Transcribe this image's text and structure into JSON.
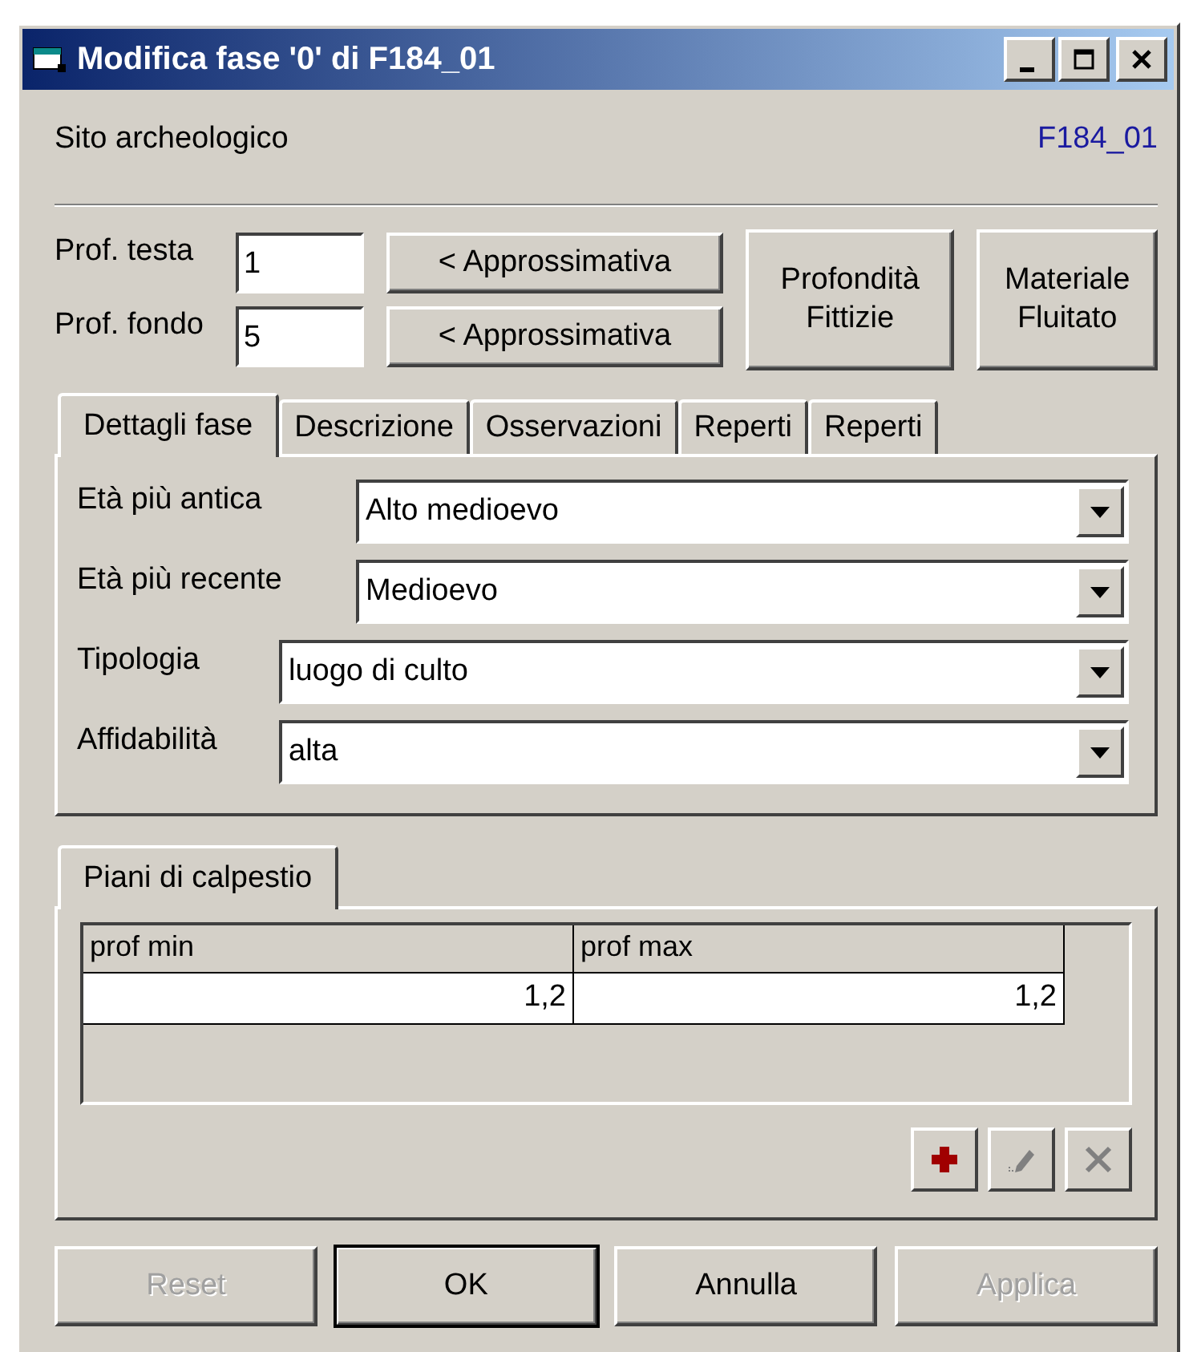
{
  "window": {
    "title": "Modifica fase '0' di F184_01"
  },
  "site": {
    "label": "Sito archeologico",
    "code": "F184_01"
  },
  "depths": [
    {
      "label": "Prof. testa",
      "value": "1",
      "button": "< Approssimativa"
    },
    {
      "label": "Prof. fondo",
      "value": "5",
      "button": "< Approssimativa"
    }
  ],
  "side_buttons": [
    "Profondità Fittizie",
    "Materiale Fluitato"
  ],
  "tabs": [
    {
      "label": "Dettagli fase",
      "selected": true
    },
    {
      "label": "Descrizione",
      "selected": false
    },
    {
      "label": "Osservazioni",
      "selected": false
    },
    {
      "label": "Reperti",
      "selected": false
    },
    {
      "label": "Reperti",
      "selected": false
    }
  ],
  "fields": [
    {
      "label": "Età più antica",
      "value": "Alto medioevo"
    },
    {
      "label": "Età più recente",
      "value": "Medioevo"
    },
    {
      "label": "Tipologia",
      "value": "luogo di culto"
    },
    {
      "label": "Affidabilità",
      "value": "alta"
    }
  ],
  "floors": {
    "tab": {
      "label": "Piani di calpestio",
      "selected": true
    },
    "columns": [
      "prof min",
      "prof max"
    ],
    "rows": [
      [
        "1,2",
        "1,2"
      ]
    ],
    "tools": [
      {
        "kind": "add",
        "disabled": false
      },
      {
        "kind": "edit",
        "disabled": true
      },
      {
        "kind": "delete",
        "disabled": true
      }
    ]
  },
  "buttons": [
    {
      "label": "Reset",
      "disabled": true,
      "default": false
    },
    {
      "label": "OK",
      "disabled": false,
      "default": true
    },
    {
      "label": "Annulla",
      "disabled": false,
      "default": false
    },
    {
      "label": "Applica",
      "disabled": true,
      "default": false
    }
  ]
}
